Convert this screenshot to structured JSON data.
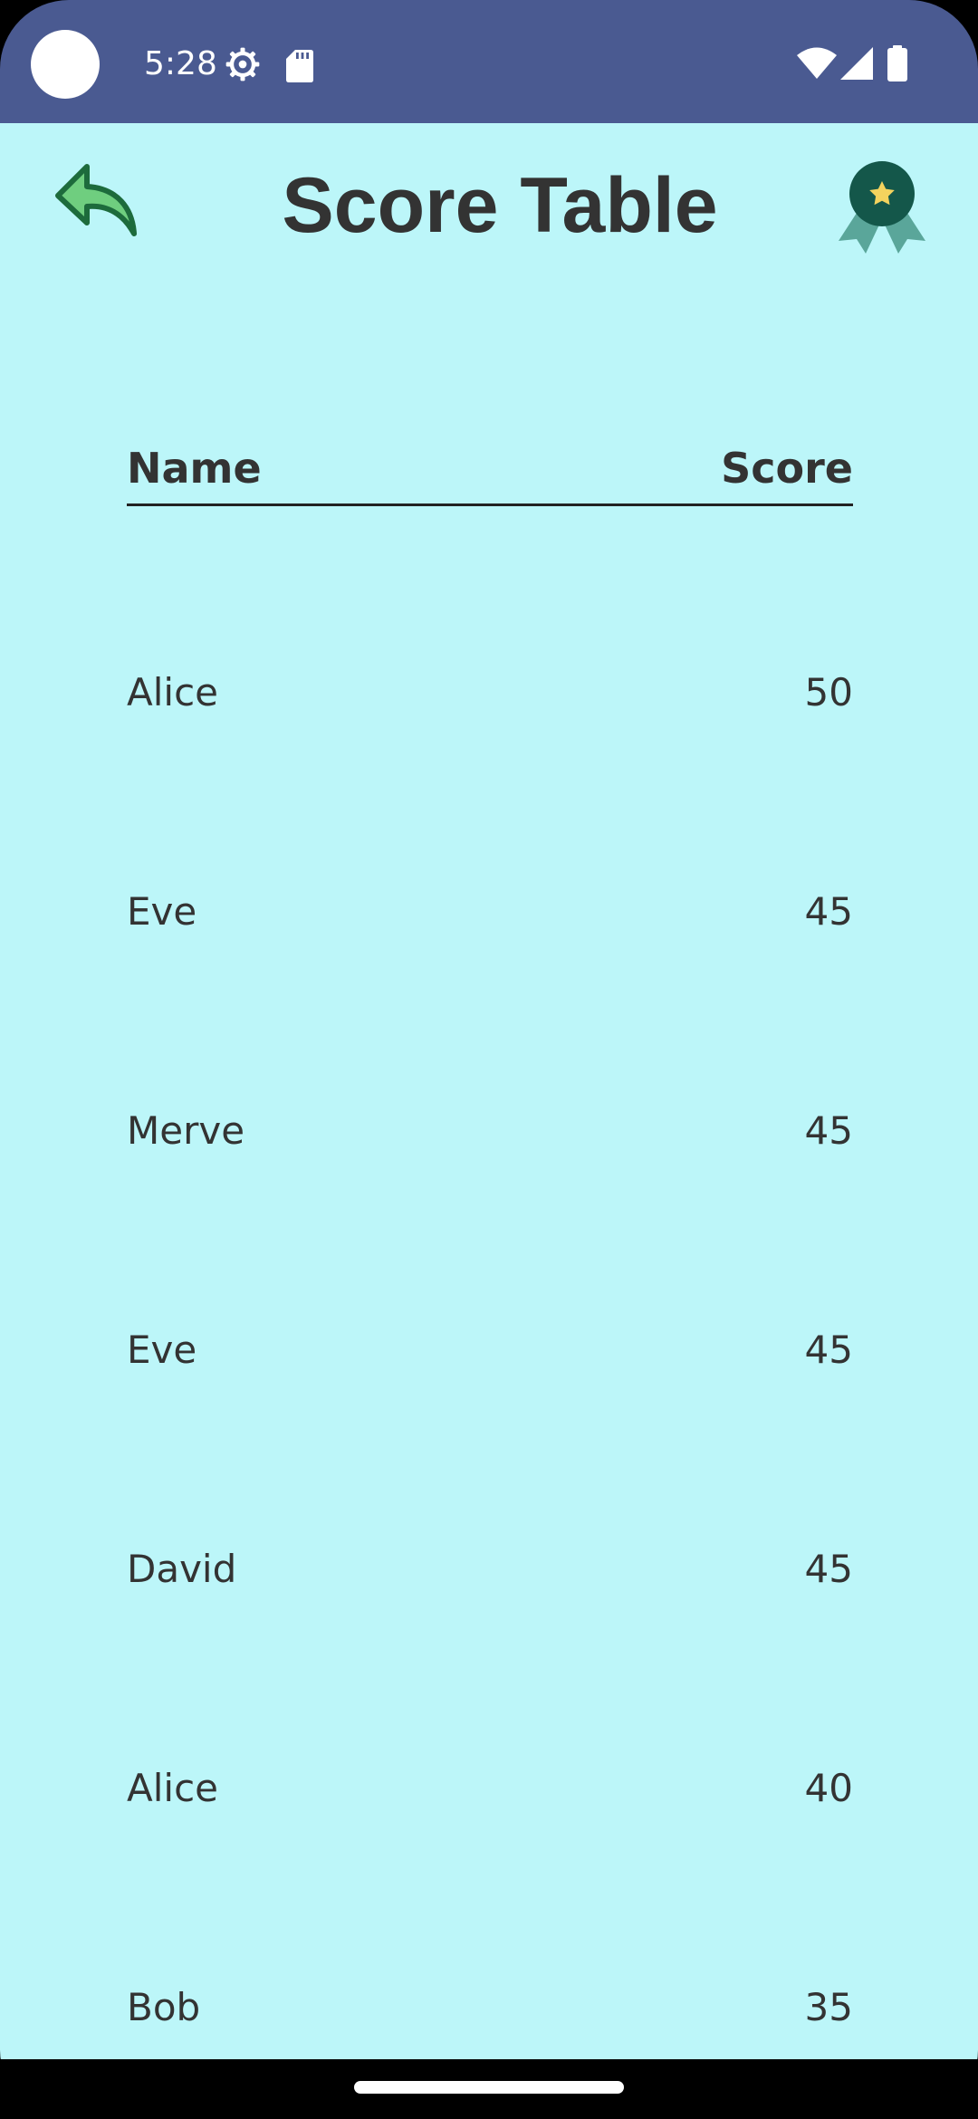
{
  "status_bar": {
    "time": "5:28",
    "icons": [
      "settings-gear-icon",
      "sd-card-icon",
      "wifi-icon",
      "cell-signal-icon",
      "battery-icon"
    ]
  },
  "header": {
    "title": "Score Table",
    "back_icon": "back-arrow-icon",
    "award_icon": "award-badge-icon"
  },
  "table": {
    "columns": [
      "Name",
      "Score"
    ],
    "rows": [
      {
        "name": "Alice",
        "score": "50"
      },
      {
        "name": "Eve",
        "score": "45"
      },
      {
        "name": "Merve",
        "score": "45"
      },
      {
        "name": "Eve",
        "score": "45"
      },
      {
        "name": "David",
        "score": "45"
      },
      {
        "name": "Alice",
        "score": "40"
      },
      {
        "name": "Bob",
        "score": "35"
      }
    ]
  },
  "colors": {
    "status_bar": "#4a5a91",
    "background": "#bcf6f9",
    "text": "#333333",
    "accent_green": "#1f6b4a",
    "star_yellow": "#f4d35e"
  }
}
